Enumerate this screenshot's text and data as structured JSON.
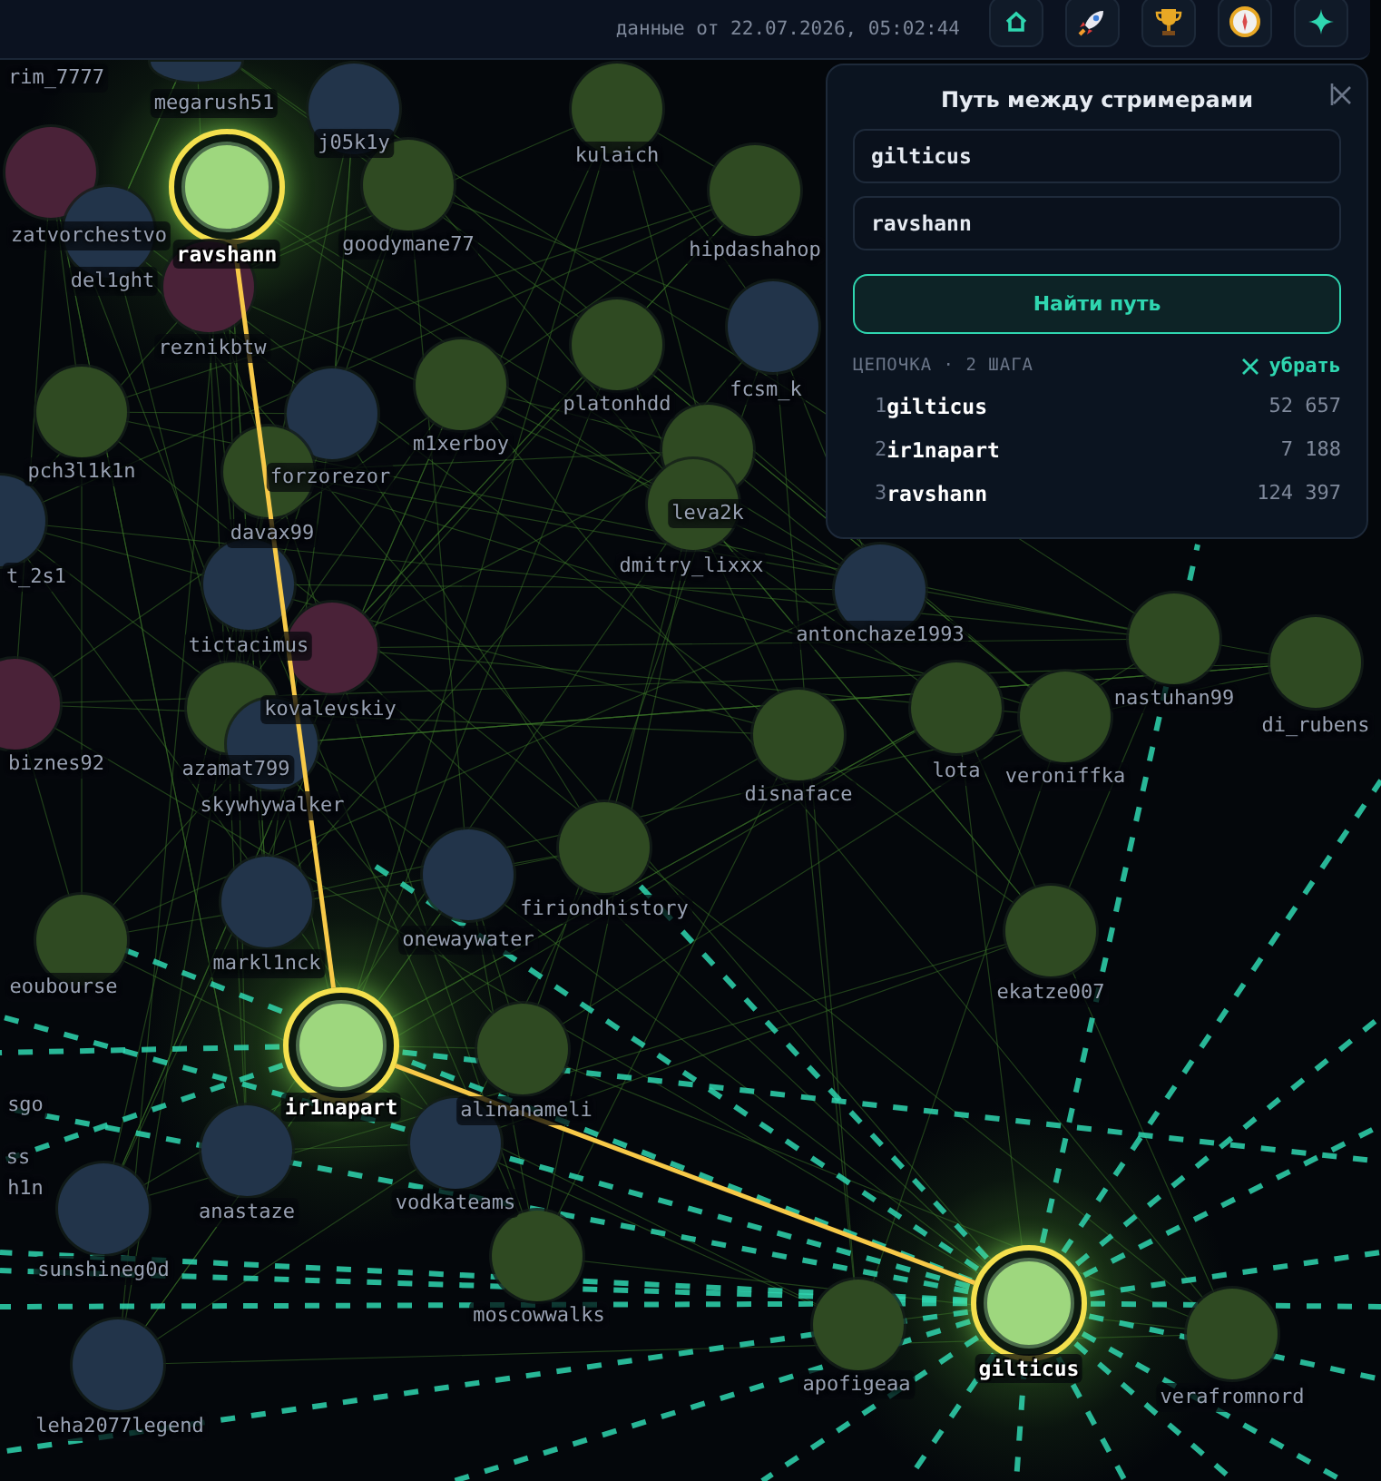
{
  "header": {
    "timestamp": "данные от 22.07.2026, 05:02:44"
  },
  "path_panel": {
    "title": "Путь между стримерами",
    "fields": [
      {
        "value": "gilticus"
      },
      {
        "value": "ravshann"
      }
    ],
    "find_button": "Найти путь",
    "chain_label": "ЦЕПОЧКА · 2 ШАГА",
    "clear_label": "убрать",
    "steps": [
      {
        "number": "1",
        "name": "gilticus",
        "count": "52 657"
      },
      {
        "number": "2",
        "name": "ir1napart",
        "count": "7 188"
      },
      {
        "number": "3",
        "name": "ravshann",
        "count": "124 397"
      }
    ]
  },
  "graph": {
    "nodes": [
      {
        "label": "rim_7777",
        "selected": false
      },
      {
        "label": "megarush51",
        "selected": false,
        "color": "#22344a"
      },
      {
        "label": "j05k1y",
        "selected": false,
        "color": "#22344a"
      },
      {
        "label": "ravshann",
        "selected": true
      },
      {
        "label": "goodymane77",
        "selected": false,
        "color": "#2f4a22"
      },
      {
        "label": "zatvorchestvo",
        "selected": false,
        "color": "#4a2238"
      },
      {
        "label": "del1ght",
        "selected": false,
        "color": "#22344a"
      },
      {
        "label": "reznikbtw",
        "selected": false,
        "color": "#4a2238"
      },
      {
        "label": "kulaich",
        "selected": false,
        "color": "#2f4a22"
      },
      {
        "label": "hipdashahop",
        "selected": false,
        "color": "#2f4a22"
      },
      {
        "label": "platonhdd",
        "selected": false,
        "color": "#2f4a22"
      },
      {
        "label": "fcsm_k",
        "selected": false,
        "color": "#22344a"
      },
      {
        "label": "m1xerboy",
        "selected": false,
        "color": "#2f4a22"
      },
      {
        "label": "forzorezor",
        "selected": false,
        "color": "#22344a"
      },
      {
        "label": "pch3l1k1n",
        "selected": false,
        "color": "#2f4a22"
      },
      {
        "label": "leva2k",
        "selected": false,
        "color": "#2f4a22"
      },
      {
        "label": "davax99",
        "selected": false,
        "color": "#2f4a22"
      },
      {
        "label": "dmitry_lixxx",
        "selected": false,
        "color": "#2f4a22"
      },
      {
        "label": "t_2s1",
        "selected": false,
        "color": "#22344a"
      },
      {
        "label": "tictacimus",
        "selected": false,
        "color": "#22344a"
      },
      {
        "label": "antonchaze1993",
        "selected": false,
        "color": "#22344a"
      },
      {
        "label": "nastuhan99",
        "selected": false,
        "color": "#2f4a22"
      },
      {
        "label": "kovalevskiy",
        "selected": false,
        "color": "#4a2238"
      },
      {
        "label": "di_rubens",
        "selected": false,
        "color": "#2f4a22"
      },
      {
        "label": "lota",
        "selected": false,
        "color": "#2f4a22"
      },
      {
        "label": "veroniffka",
        "selected": false,
        "color": "#2f4a22"
      },
      {
        "label": "biznes92",
        "selected": false,
        "color": "#4a2238"
      },
      {
        "label": "azamat799",
        "selected": false,
        "color": "#2f4a22"
      },
      {
        "label": "skywhywalker",
        "selected": false,
        "color": "#22344a"
      },
      {
        "label": "disnaface",
        "selected": false,
        "color": "#2f4a22"
      },
      {
        "label": "firiondhistory",
        "selected": false,
        "color": "#2f4a22"
      },
      {
        "label": "onewaywater",
        "selected": false,
        "color": "#22344a"
      },
      {
        "label": "markl1nck",
        "selected": false,
        "color": "#22344a"
      },
      {
        "label": "eoubourse",
        "selected": false,
        "color": "#2f4a22"
      },
      {
        "label": "ekatze007",
        "selected": false,
        "color": "#2f4a22"
      },
      {
        "label": "sgo",
        "selected": false
      },
      {
        "label": "ir1napart",
        "selected": true
      },
      {
        "label": "alinanameli",
        "selected": false,
        "color": "#2f4a22"
      },
      {
        "label": "ss",
        "selected": false
      },
      {
        "label": "h1n",
        "selected": false
      },
      {
        "label": "vodkateams",
        "selected": false,
        "color": "#22344a"
      },
      {
        "label": "anastaze",
        "selected": false,
        "color": "#22344a"
      },
      {
        "label": "sunshineg0d",
        "selected": false,
        "color": "#22344a"
      },
      {
        "label": "moscowwalks",
        "selected": false,
        "color": "#2f4a22"
      },
      {
        "label": "gilticus",
        "selected": true
      },
      {
        "label": "apofigeaa",
        "selected": false,
        "color": "#2f4a22"
      },
      {
        "label": "verafromnord",
        "selected": false,
        "color": "#2f4a22"
      },
      {
        "label": "leha2077legend",
        "selected": false,
        "color": "#22344a"
      }
    ]
  }
}
